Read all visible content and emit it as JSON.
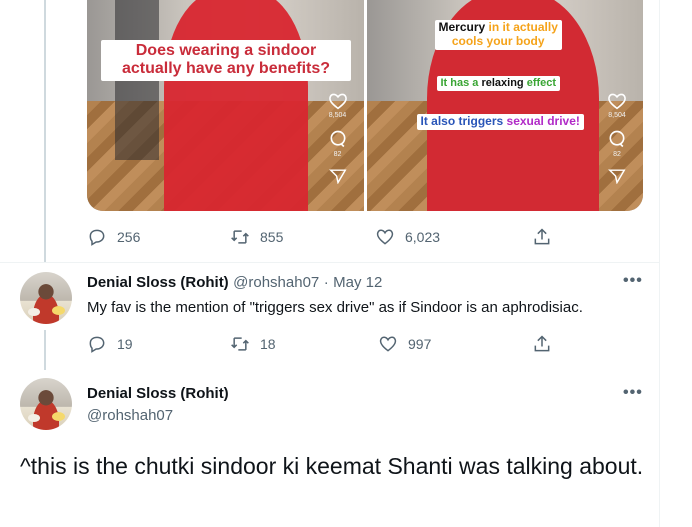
{
  "media": {
    "left_video": {
      "caption_line1": "Does wearing a sindoor",
      "caption_line2": "actually have any benefits?",
      "likes": "8,504",
      "comments": "82"
    },
    "right_video": {
      "cap_a_black": "Mercury",
      "cap_a_orange": "in it actually",
      "cap_a_orange2": "cools your body",
      "cap_b_green1": "It has a",
      "cap_b_black": "relaxing",
      "cap_b_green2": "effect",
      "cap_c_blue": "It also triggers",
      "cap_c_purple": "sexual drive!",
      "likes": "8,504",
      "comments": "82"
    }
  },
  "main_tweet_actions": {
    "replies": "256",
    "retweets": "855",
    "likes": "6,023"
  },
  "reply": {
    "name": "Denial Sloss (Rohit)",
    "handle": "@rohshah07",
    "separator": "·",
    "date": "May 12",
    "text": "My fav is the mention of \"triggers sex drive\" as if Sindoor is an aphrodisiac.",
    "replies": "19",
    "retweets": "18",
    "likes": "997"
  },
  "focused_tweet": {
    "name": "Denial Sloss (Rohit)",
    "handle": "@rohshah07",
    "text": "^this is the chutki sindoor ki keemat Shanti was talking about."
  },
  "more_label": "•••",
  "colors": {
    "accent_red": "#c92c3a",
    "icon_gray": "#536471",
    "text": "#0f1419"
  }
}
